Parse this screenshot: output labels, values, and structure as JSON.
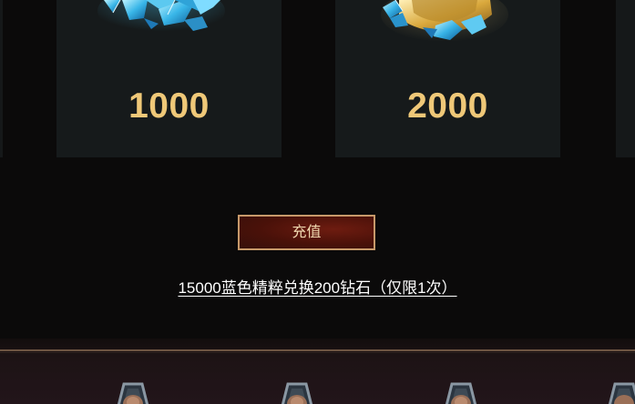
{
  "cards": [
    {
      "amount": "1000",
      "icon": "crystal-pile-icon"
    },
    {
      "amount": "2000",
      "icon": "crystal-gold-chest-icon"
    }
  ],
  "recharge_button": {
    "label": "充值"
  },
  "exchange_link": {
    "text": "15000蓝色精粹兑换200钻石（仅限1次）"
  },
  "bottom_bar": {
    "emblems": [
      "rank-emblem-icon",
      "rank-emblem-icon",
      "rank-emblem-icon",
      "rank-emblem-icon"
    ]
  },
  "colors": {
    "amount": "#efc878",
    "button_border": "#c7996a",
    "button_bg": "#4a1109",
    "card_bg": "#161a1b",
    "page_bg": "#0b0a0a"
  }
}
